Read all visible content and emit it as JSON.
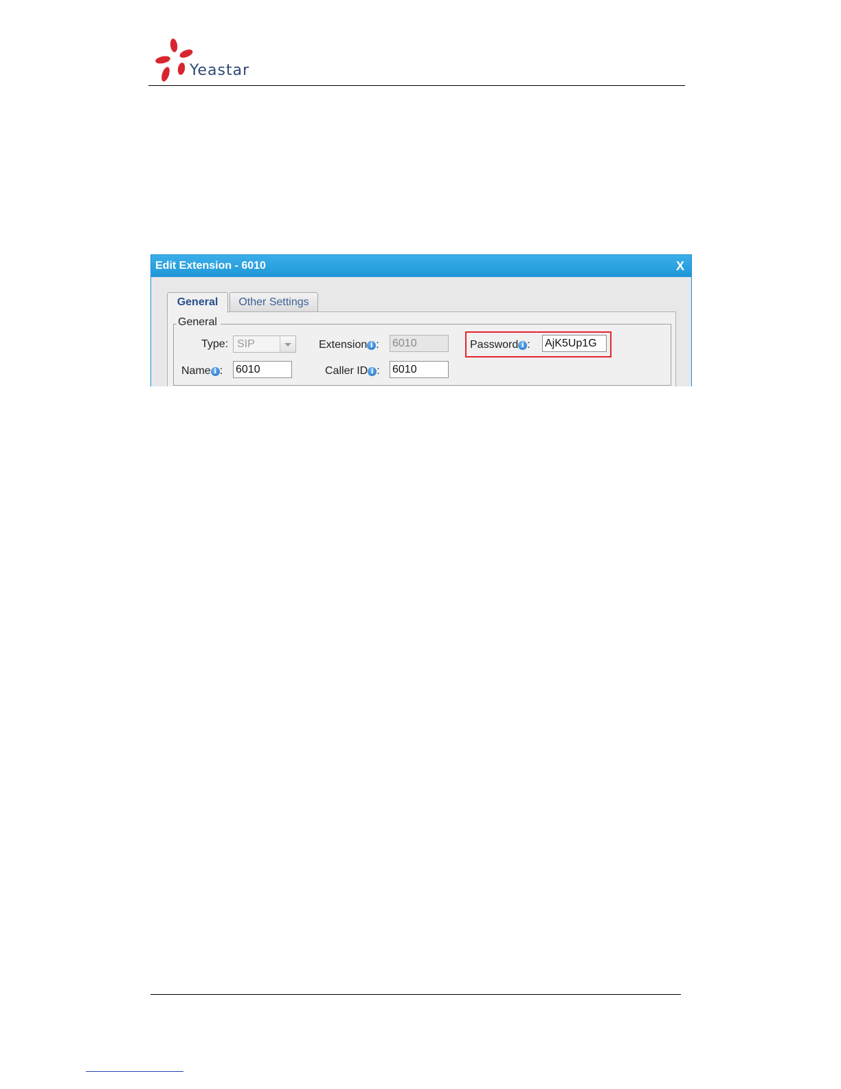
{
  "logo": {
    "brand": "Yeastar",
    "colors": {
      "petals": "#d72630",
      "text": "#2f4a73"
    }
  },
  "dialog": {
    "title": "Edit Extension - 6010",
    "close_label": "X",
    "tabs": [
      {
        "label": "General",
        "active": true
      },
      {
        "label": "Other Settings",
        "active": false
      }
    ],
    "section_legend": "General",
    "fields": {
      "type": {
        "label": "Type:",
        "value": "SIP",
        "disabled": true
      },
      "extension": {
        "label": "Extension",
        "colon": ":",
        "value": "6010",
        "disabled": true,
        "icon": "info-icon"
      },
      "password": {
        "label": "Password",
        "colon": ":",
        "value": "AjK5Up1G",
        "icon": "info-icon",
        "highlighted": true
      },
      "name": {
        "label": "Name",
        "colon": ":",
        "value": "6010",
        "icon": "info-icon"
      },
      "caller_id": {
        "label": "Caller ID",
        "colon": ":",
        "value": "6010",
        "icon": "info-icon"
      }
    },
    "colors": {
      "titlebar": "#2ba2e0",
      "highlight": "#e2262e",
      "active_tab_text": "#284f8c"
    }
  }
}
